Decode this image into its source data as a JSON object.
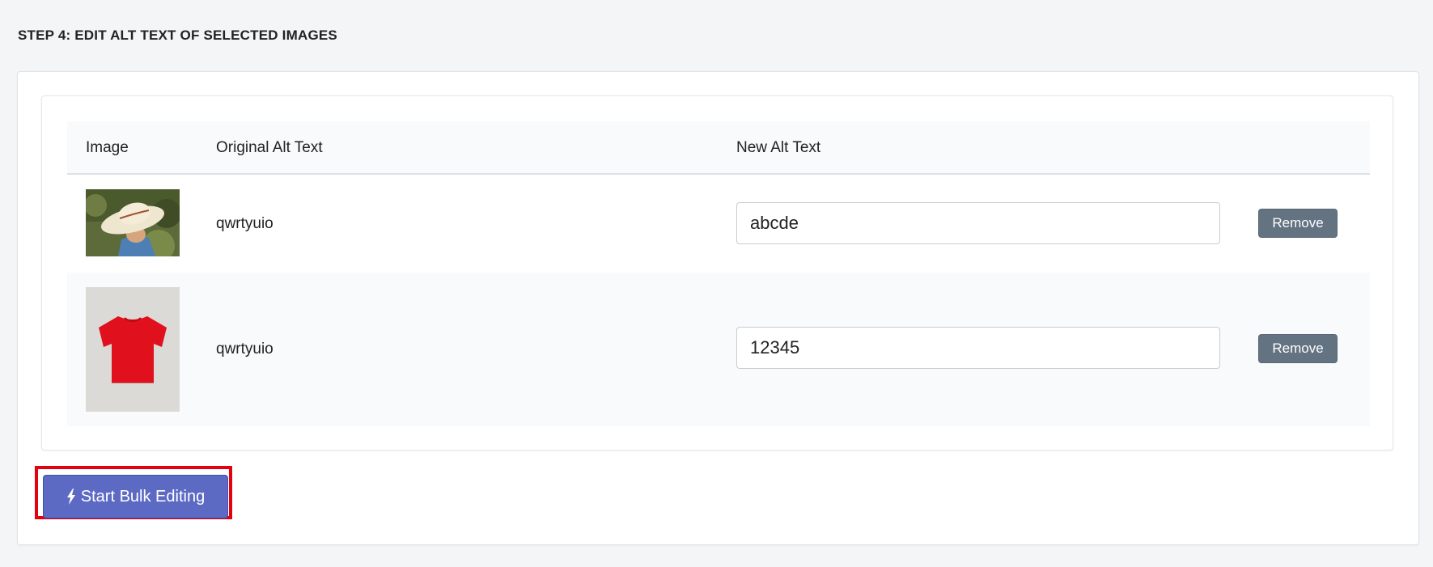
{
  "step_heading": "STEP 4: EDIT ALT TEXT OF SELECTED IMAGES",
  "table": {
    "headers": {
      "image": "Image",
      "original_alt_text": "Original Alt Text",
      "new_alt_text": "New Alt Text"
    },
    "rows": [
      {
        "image_icon": "cowboy-hat-photo",
        "original_alt_text": "qwrtyuio",
        "new_alt_text": "abcde",
        "remove_label": "Remove"
      },
      {
        "image_icon": "red-tshirt-photo",
        "original_alt_text": "qwrtyuio",
        "new_alt_text": "12345",
        "remove_label": "Remove"
      }
    ]
  },
  "bulk_button": {
    "label": "Start Bulk Editing",
    "icon": "lightning-bolt-icon"
  },
  "colors": {
    "primary": "#5c6ac4",
    "remove_button": "#637381",
    "highlight": "#e3000f"
  }
}
